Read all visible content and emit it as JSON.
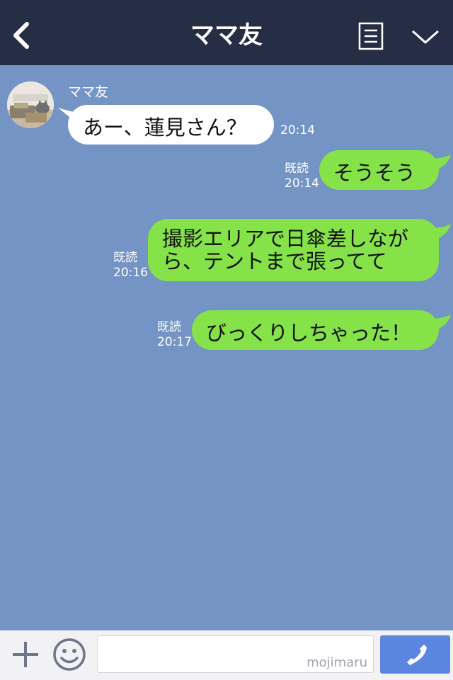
{
  "header": {
    "title": "ママ友",
    "back_icon": "chevron-left-icon",
    "menu_icon": "document-menu-icon",
    "expand_icon": "chevron-down-icon",
    "bg_color": "#252e45"
  },
  "chat": {
    "bg_color": "#7394c4",
    "contact_name": "ママ友",
    "messages": [
      {
        "direction": "incoming",
        "text": "あー、蓮見さん？",
        "time": "20:14",
        "read": ""
      },
      {
        "direction": "outgoing",
        "text": "そうそう",
        "time": "20:14",
        "read": "既読"
      },
      {
        "direction": "outgoing",
        "lines": [
          "撮影エリアで日傘差しなが",
          "ら、テントまで張ってて"
        ],
        "time": "20:16",
        "read": "既読"
      },
      {
        "direction": "outgoing",
        "text": "びっくりしちゃった！",
        "time": "20:17",
        "read": "既読"
      }
    ]
  },
  "footer": {
    "plus_icon": "plus-icon",
    "emoji_icon": "smiley-icon",
    "input_value": "",
    "watermark": "mojimaru",
    "call_icon": "phone-icon",
    "call_color": "#5a86e0"
  }
}
